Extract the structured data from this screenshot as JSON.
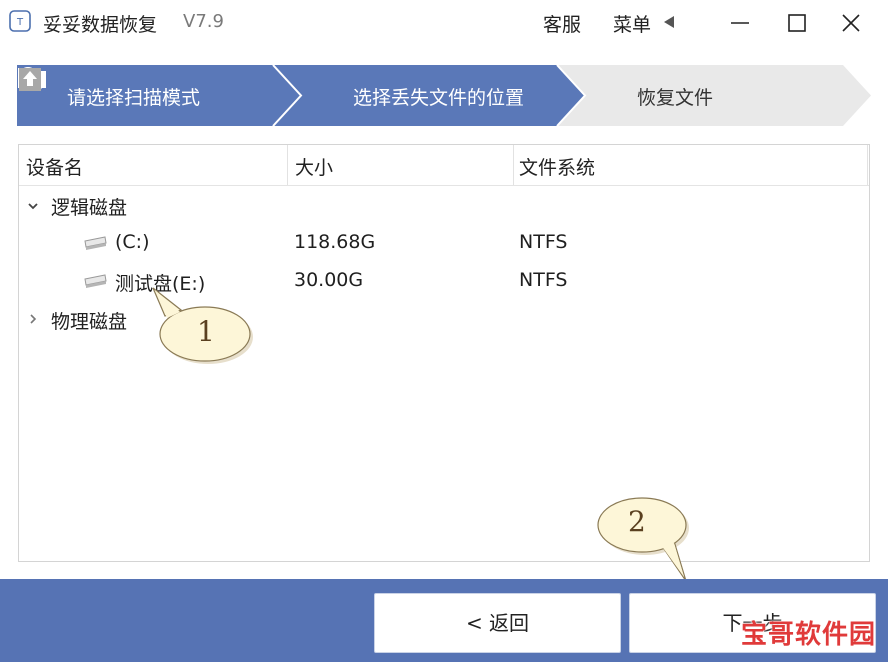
{
  "window": {
    "title": "妥妥数据恢复",
    "version": "V7.9",
    "support_label": "客服",
    "menu_label": "菜单"
  },
  "steps": [
    {
      "label": "请选择扫描模式",
      "state": "done",
      "icon": "search-icon"
    },
    {
      "label": "选择丢失文件的位置",
      "state": "active",
      "icon": "folder-icon"
    },
    {
      "label": "恢复文件",
      "state": "pending",
      "icon": "upload-icon"
    }
  ],
  "table": {
    "columns": [
      "设备名",
      "大小",
      "文件系统"
    ],
    "groups": [
      {
        "label": "逻辑磁盘",
        "expanded": true,
        "rows": [
          {
            "name": "(C:)",
            "size": "118.68G",
            "fs": "NTFS"
          },
          {
            "name": "测试盘(E:)",
            "size": "30.00G",
            "fs": "NTFS"
          }
        ]
      },
      {
        "label": "物理磁盘",
        "expanded": false,
        "rows": []
      }
    ]
  },
  "callouts": [
    "1",
    "2"
  ],
  "buttons": {
    "back": "< 返回",
    "next": "下一步"
  },
  "watermark": "宝哥软件园",
  "colors": {
    "accent": "#5673b4",
    "step_active": "#5a78b8",
    "step_pending": "#e9e9e9",
    "callout_fill": "#fdf6d8",
    "watermark": "#e03a3a"
  }
}
